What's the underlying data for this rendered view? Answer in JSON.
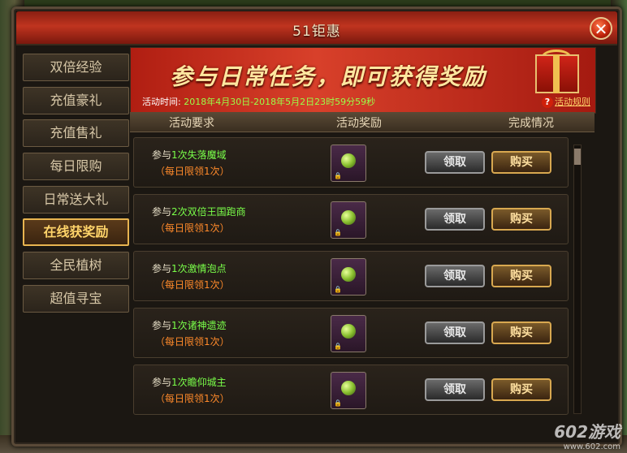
{
  "window": {
    "title": "51钜惠",
    "close_label": "✕"
  },
  "sidebar": {
    "items": [
      {
        "label": "双倍经验"
      },
      {
        "label": "充值豪礼"
      },
      {
        "label": "充值售礼"
      },
      {
        "label": "每日限购"
      },
      {
        "label": "日常送大礼"
      },
      {
        "label": "在线获奖励",
        "active": true
      },
      {
        "label": "全民植树"
      },
      {
        "label": "超值寻宝"
      }
    ]
  },
  "banner": {
    "title": "参与日常任务，即可获得奖励",
    "time_label": "活动时间:",
    "time_value": "2018年4月30日-2018年5月2日23时59分59秒",
    "rules_label": "活动规则",
    "rules_icon": "?"
  },
  "header": {
    "col1": "活动要求",
    "col2": "活动奖励",
    "col3": "完成情况"
  },
  "rows": [
    {
      "prefix": "参与",
      "task": "1次失落魔域",
      "limit": "（每日限领1次）",
      "claim": "领取",
      "buy": "购买"
    },
    {
      "prefix": "参与",
      "task": "2次双倍王国跑商",
      "limit": "（每日限领1次）",
      "claim": "领取",
      "buy": "购买"
    },
    {
      "prefix": "参与",
      "task": "1次激情泡点",
      "limit": "（每日限领1次）",
      "claim": "领取",
      "buy": "购买"
    },
    {
      "prefix": "参与",
      "task": "1次诸神遗迹",
      "limit": "（每日限领1次）",
      "claim": "领取",
      "buy": "购买"
    },
    {
      "prefix": "参与",
      "task": "1次瞻仰城主",
      "limit": "（每日限领1次）",
      "claim": "领取",
      "buy": "购买"
    }
  ],
  "watermark": {
    "text": "602游戏",
    "url": "www.602.com"
  },
  "colors": {
    "accent": "#e8b450",
    "highlight": "#7aff4a",
    "limit": "#ff8a2a",
    "banner": "#c0341f"
  }
}
